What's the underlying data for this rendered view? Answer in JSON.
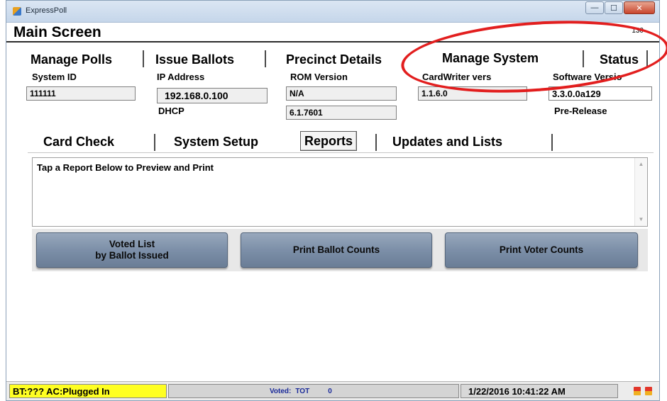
{
  "window": {
    "app_title": "ExpressPoll",
    "buttons": {
      "minimize": "—",
      "maximize": "☐",
      "close": "✕"
    }
  },
  "header": {
    "title": "Main Screen",
    "number": "130"
  },
  "top_tabs": [
    {
      "label": "Manage Polls"
    },
    {
      "label": "Issue Ballots"
    },
    {
      "label": "Precinct Details"
    },
    {
      "label": "Manage System",
      "selected": true
    },
    {
      "label": "Status"
    }
  ],
  "system_info": {
    "system_id": {
      "label": "System ID",
      "value": "111111"
    },
    "ip_address": {
      "label": "IP Address",
      "value": "192.168.0.100"
    },
    "dhcp": {
      "label": "DHCP"
    },
    "rom_version": {
      "label": "ROM Version",
      "value": "N/A"
    },
    "rom_value_2": "6.1.7601",
    "cardwriter": {
      "label": "CardWriter vers",
      "value": "1.1.6.0"
    },
    "software": {
      "label": "Software Versio",
      "value": "3.3.0.0a129",
      "release": "Pre-Release"
    }
  },
  "sub_tabs": [
    {
      "label": "Card Check"
    },
    {
      "label": "System Setup"
    },
    {
      "label": "Reports",
      "selected": true
    },
    {
      "label": "Updates and Lists"
    }
  ],
  "reports": {
    "instruction": "Tap a Report Below to Preview and Print",
    "buttons": [
      {
        "line1": "Voted List",
        "line2": "by Ballot Issued"
      },
      {
        "line1": "Print Ballot Counts"
      },
      {
        "line1": "Print Voter Counts"
      }
    ]
  },
  "status_bar": {
    "battery": "BT:??? AC:Plugged In",
    "voted_label": "Voted:",
    "voted_type": "TOT",
    "voted_count": "0",
    "datetime": "1/22/2016 10:41:22 AM",
    "icons": [
      "plug-icon",
      "battery-icon"
    ]
  },
  "colors": {
    "callout": "#e21e1e",
    "battery_bg": "#ffff22",
    "button_bg": "#7c8fa8",
    "voted_text": "#1a2a9a"
  }
}
